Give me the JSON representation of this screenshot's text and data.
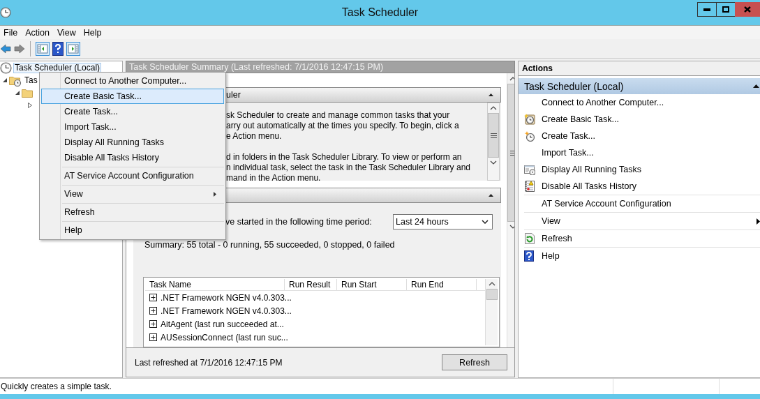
{
  "window": {
    "title": "Task Scheduler"
  },
  "menu_bar": [
    "File",
    "Action",
    "View",
    "Help"
  ],
  "toolbar": [
    {
      "kind": "back",
      "disabled": false
    },
    {
      "kind": "forward",
      "disabled": true
    },
    {
      "kind": "treetoggle"
    },
    {
      "kind": "help"
    },
    {
      "kind": "actionpane"
    }
  ],
  "tree": [
    {
      "label": "Task Scheduler (Local)",
      "selected": true,
      "children": [
        {
          "label": "Tas",
          "expanded": true,
          "children": [
            {
              "expanded": true,
              "children": [
                {
                  "expanded": false
                }
              ]
            }
          ]
        }
      ]
    }
  ],
  "summary_pane": {
    "title": "Task Scheduler Summary (Last refreshed: 7/1/2016 12:47:15 PM)",
    "overview": {
      "title": "uler",
      "expanded": true,
      "paragraphs": [
        "sk Scheduler to create and manage common tasks that your\narry out automatically at the times you specify. To begin, click a\ne Action menu.",
        "d in folders in the Task Scheduler Library. To view or perform an\nn individual task, select the task in the Task Scheduler Library and\nmand in the Action menu."
      ]
    },
    "status": {
      "expanded": true,
      "period_label": "ve started in the following time period:",
      "period": "Last 24 hours",
      "summary": "Summary: 55 total - 0 running, 55 succeeded, 0 stopped, 0 failed",
      "table": {
        "columns": [
          "Task Name",
          "Run Result",
          "Run Start",
          "Run End"
        ],
        "rows": [
          {
            "name": ".NET Framework NGEN v4.0.303...",
            "expanded": false
          },
          {
            "name": ".NET Framework NGEN v4.0.303...",
            "expanded": false
          },
          {
            "name": "AitAgent (last run succeeded at...",
            "expanded": false
          },
          {
            "name": "AUSessionConnect (last run suc...",
            "expanded": false
          }
        ]
      }
    },
    "last_refreshed": "Last refreshed at 7/1/2016 12:47:15 PM",
    "refresh_button": "Refresh"
  },
  "actions": {
    "title": "Actions",
    "group": {
      "title": "Task Scheduler (Local)",
      "expanded": true
    },
    "items": [
      {
        "label": "Connect to Another Computer...",
        "kind": "plain"
      },
      {
        "label": "Create Basic Task...",
        "kind": "basictask"
      },
      {
        "label": "Create Task...",
        "kind": "newtask"
      },
      {
        "label": "Import Task...",
        "kind": "plain"
      },
      {
        "label": "Display All Running Tasks",
        "kind": "running"
      },
      {
        "label": "Disable All Tasks History",
        "kind": "history"
      },
      {
        "label": "AT Service Account Configuration",
        "kind": "plain",
        "separator": true
      },
      {
        "label": "View",
        "kind": "plain",
        "separator": true,
        "submenu": true
      },
      {
        "label": "Refresh",
        "kind": "refresh",
        "separator": true
      },
      {
        "label": "Help",
        "kind": "help",
        "separator": true
      }
    ]
  },
  "context_menu": [
    {
      "label": "Connect to Another Computer...",
      "selected": false
    },
    {
      "label": "Create Basic Task...",
      "selected": true
    },
    {
      "label": "Create Task...",
      "selected": false
    },
    {
      "label": "Import Task...",
      "selected": false
    },
    {
      "label": "Display All Running Tasks",
      "selected": false
    },
    {
      "label": "Disable All Tasks History",
      "selected": false
    },
    {
      "label": "AT Service Account Configuration",
      "selected": false,
      "separator": true
    },
    {
      "label": "View",
      "selected": false,
      "separator": true,
      "submenu": true
    },
    {
      "label": "Refresh",
      "selected": false,
      "separator": true
    },
    {
      "label": "Help",
      "selected": false,
      "separator": true
    }
  ],
  "status_bar": "Quickly creates a simple task."
}
